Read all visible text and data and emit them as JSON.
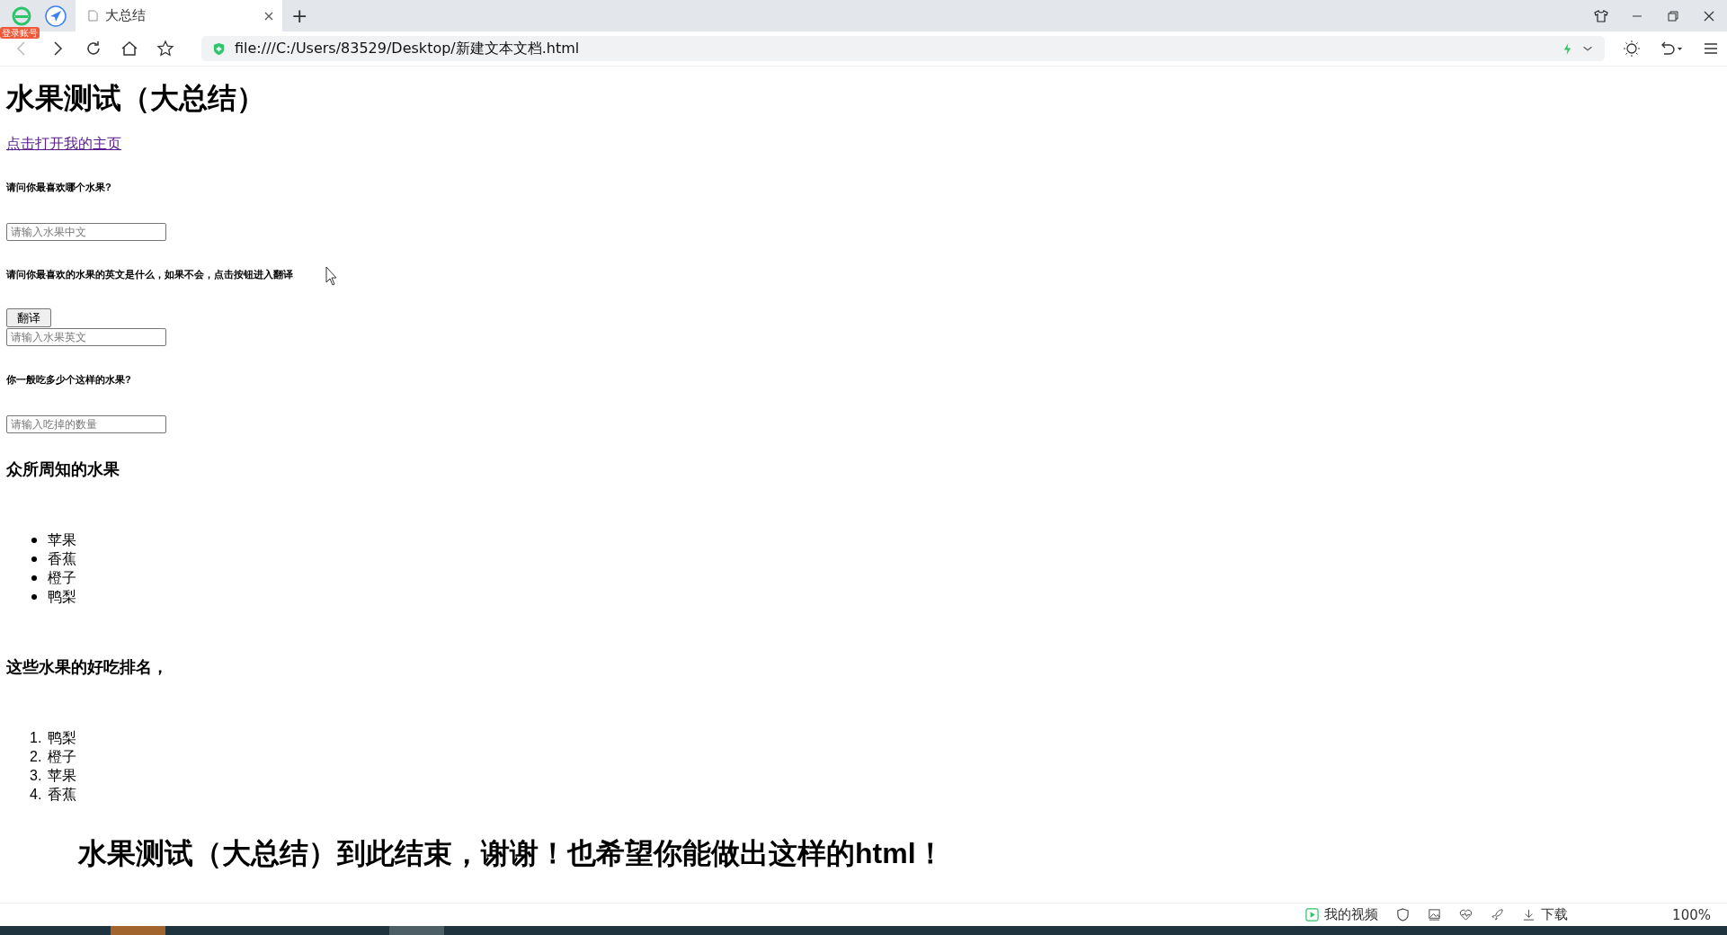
{
  "browser": {
    "account_badge": "登录账号",
    "tabs": [
      {
        "title": "大总结",
        "selected": true
      }
    ],
    "new_tab": "+",
    "address": "file:///C:/Users/83529/Desktop/新建文本文档.html"
  },
  "page": {
    "title": "水果测试（大总结）",
    "link": "点击打开我的主页",
    "form": [
      {
        "kind": "question",
        "text": "请问你最喜欢哪个水果?"
      },
      {
        "kind": "input",
        "placeholder": "请输入水果中文"
      },
      {
        "kind": "question",
        "text": "请问你最喜欢的水果的英文是什么，如果不会，点击按钮进入翻译"
      },
      {
        "kind": "button",
        "text": "翻译"
      },
      {
        "kind": "input",
        "placeholder": "请输入水果英文"
      },
      {
        "kind": "question",
        "text": "你一般吃多少个这样的水果?"
      },
      {
        "kind": "input",
        "placeholder": "请输入吃掉的数量"
      }
    ],
    "known_heading": "众所周知的水果",
    "known_fruits": [
      "苹果",
      "香蕉",
      "橙子",
      "鸭梨"
    ],
    "ranking_heading": "这些水果的好吃排名，",
    "ranking": [
      {
        "number": "1.",
        "name": "鸭梨"
      },
      {
        "number": "2.",
        "name": "橙子"
      },
      {
        "number": "3.",
        "name": "苹果"
      },
      {
        "number": "4.",
        "name": "香蕉"
      }
    ],
    "closing": "水果测试（大总结）到此结束，谢谢！也希望你能做出这样的html！"
  },
  "status_bar": {
    "videos": "我的视频",
    "download": "下载",
    "zoom": "100%"
  }
}
